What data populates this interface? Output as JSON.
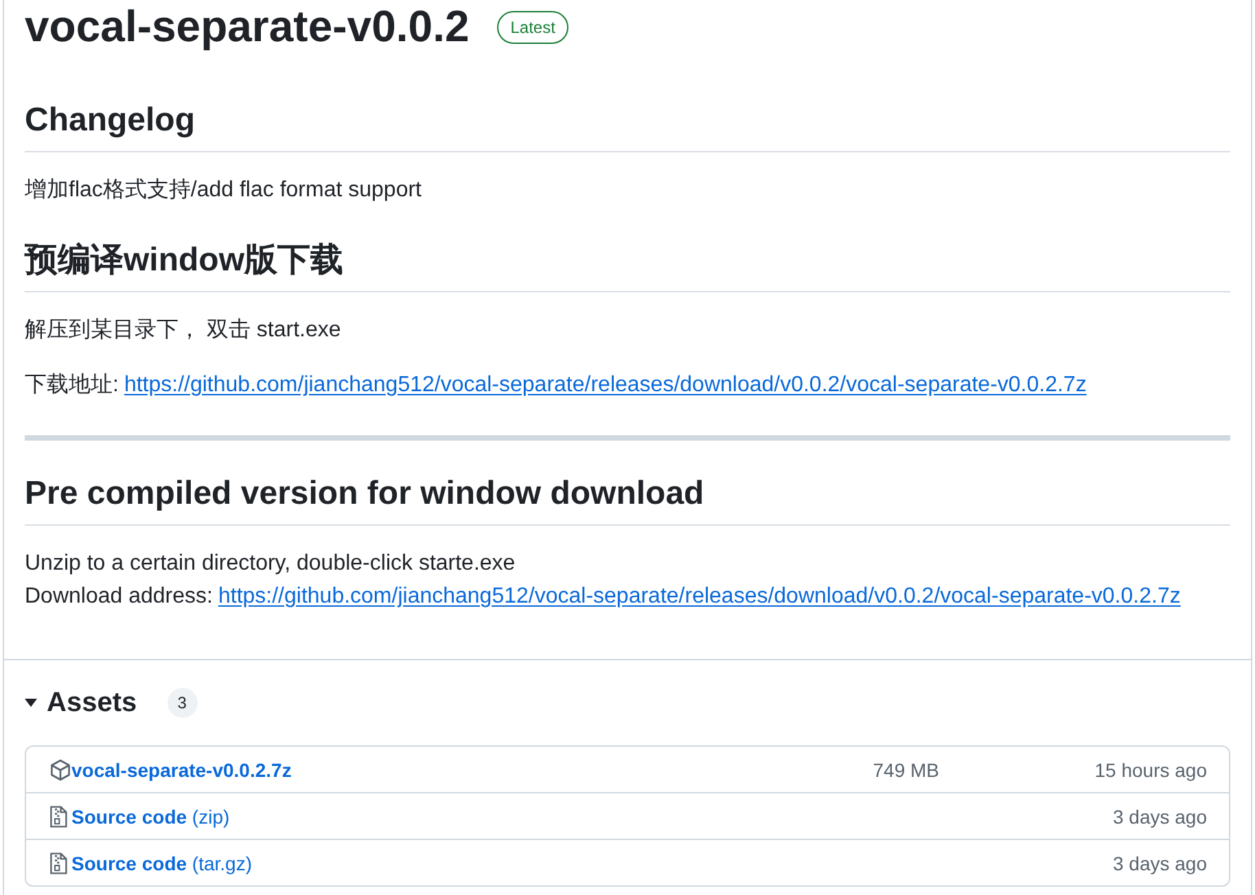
{
  "release": {
    "title": "vocal-separate-v0.0.2",
    "badge": "Latest"
  },
  "body": [
    {
      "kind": "heading",
      "text": "Changelog"
    },
    {
      "kind": "paragraph",
      "lines": [
        {
          "text": "增加flac格式支持/add flac format support"
        }
      ]
    },
    {
      "kind": "heading",
      "text": "预编译window版下载"
    },
    {
      "kind": "paragraph",
      "lines": [
        {
          "text": "解压到某目录下， 双击 start.exe"
        }
      ]
    },
    {
      "kind": "paragraph",
      "lines": [
        {
          "text": "下载地址:",
          "link": "https://github.com/jianchang512/vocal-separate/releases/download/v0.0.2/vocal-separate-v0.0.2.7z"
        }
      ]
    },
    {
      "kind": "rule"
    },
    {
      "kind": "heading",
      "text": "Pre compiled version for window download"
    },
    {
      "kind": "paragraph",
      "lines": [
        {
          "text": "Unzip to a certain directory, double-click starte.exe"
        },
        {
          "text": "Download address:",
          "link": "https://github.com/jianchang512/vocal-separate/releases/download/v0.0.2/vocal-separate-v0.0.2.7z"
        }
      ]
    }
  ],
  "assets": {
    "title": "Assets",
    "count": "3",
    "expanded": true,
    "items": [
      {
        "kind": "package",
        "name": "vocal-separate-v0.0.2.7z",
        "size": "749 MB",
        "time": "15 hours ago"
      },
      {
        "kind": "source",
        "name": "**Source code** (zip)",
        "time": "3 days ago"
      },
      {
        "kind": "source",
        "name": "**Source code** (tar.gz)",
        "time": "3 days ago"
      }
    ]
  }
}
